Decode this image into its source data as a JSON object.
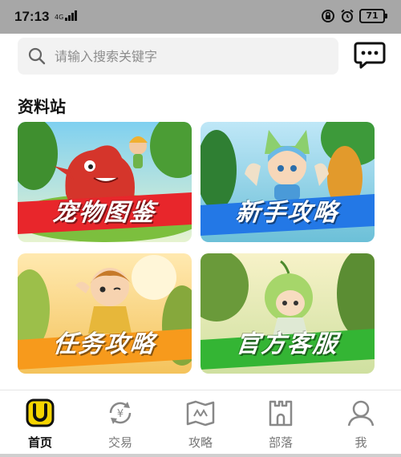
{
  "status_bar": {
    "time": "17:13",
    "network": "4G",
    "battery": "71"
  },
  "search": {
    "placeholder": "请输入搜索关键字"
  },
  "section": {
    "title": "资料站"
  },
  "cards": [
    {
      "label": "宠物图鉴",
      "banner_color": "#e8262b"
    },
    {
      "label": "新手攻略",
      "banner_color": "#2378e6"
    },
    {
      "label": "任务攻略",
      "banner_color": "#f79a1c"
    },
    {
      "label": "官方客服",
      "banner_color": "#34b534"
    }
  ],
  "nav": {
    "items": [
      {
        "label": "首页",
        "icon": "home-icon",
        "active": true
      },
      {
        "label": "交易",
        "icon": "trade-icon",
        "active": false
      },
      {
        "label": "攻略",
        "icon": "guide-icon",
        "active": false
      },
      {
        "label": "部落",
        "icon": "tribe-icon",
        "active": false
      },
      {
        "label": "我",
        "icon": "profile-icon",
        "active": false
      }
    ]
  },
  "colors": {
    "accent": "#f5d400",
    "status_bar": "#a7a7a7"
  }
}
